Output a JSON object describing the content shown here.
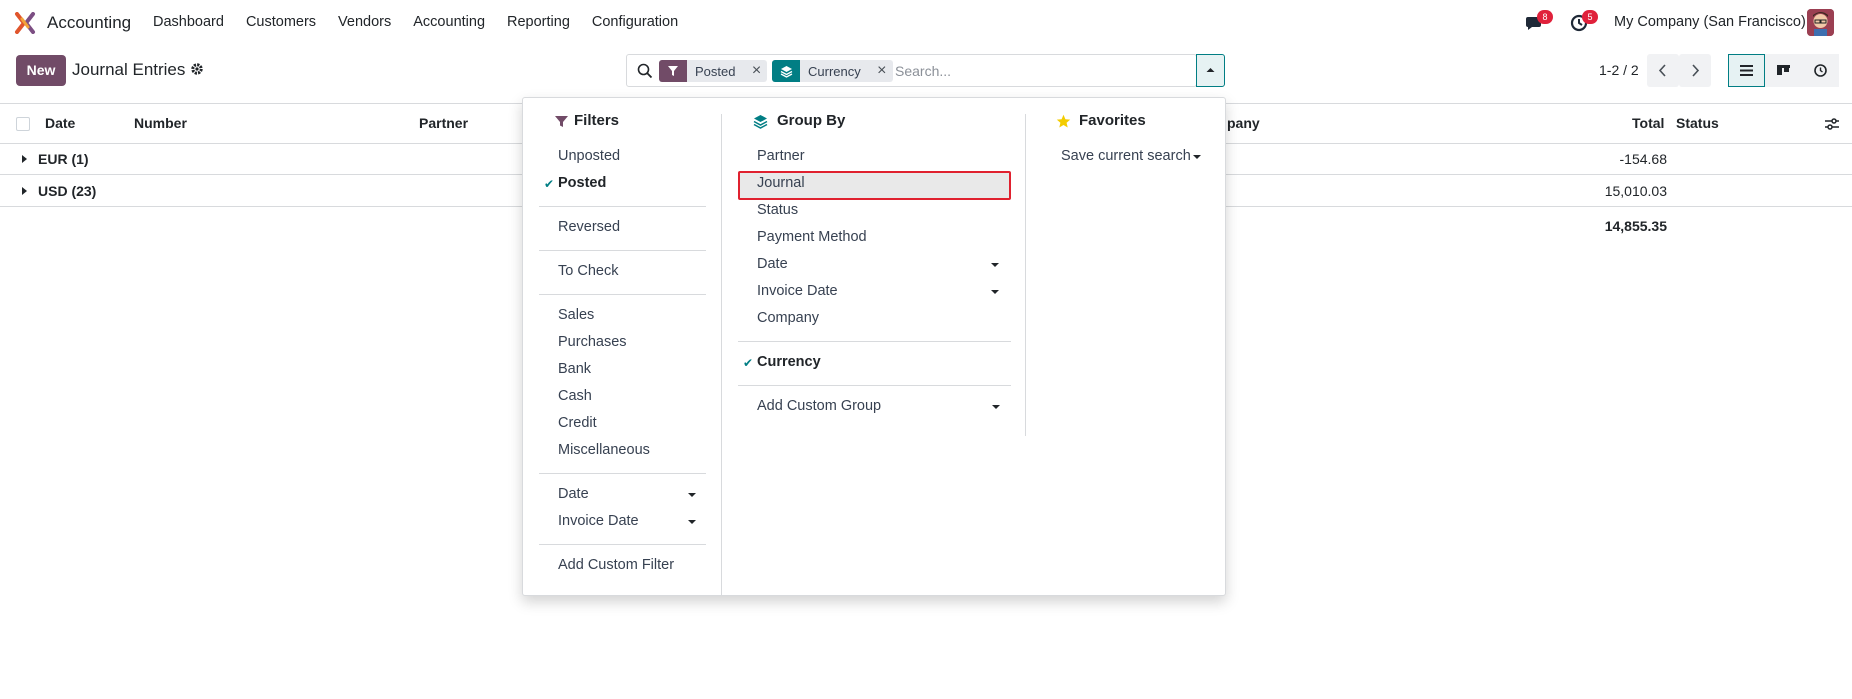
{
  "navbar": {
    "app_name": "Accounting",
    "menu": [
      "Dashboard",
      "Customers",
      "Vendors",
      "Accounting",
      "Reporting",
      "Configuration"
    ],
    "messages_count": "8",
    "activities_count": "5",
    "company": "My Company (San Francisco)"
  },
  "control_panel": {
    "new_label": "New",
    "title": "Journal Entries",
    "search": {
      "facets": [
        {
          "icon": "filter-icon",
          "label": "Posted",
          "color": "#714b67"
        },
        {
          "icon": "layers-icon",
          "label": "Currency",
          "color": "#017e84"
        }
      ],
      "placeholder": "Search..."
    },
    "pager": "1-2 / 2"
  },
  "list": {
    "columns": [
      "Date",
      "Number",
      "Partner",
      "pany",
      "Total",
      "Status"
    ],
    "groups": [
      {
        "label": "EUR (1)",
        "total": "-154.68"
      },
      {
        "label": "USD (23)",
        "total": "15,010.03"
      }
    ],
    "grand_total": "14,855.35"
  },
  "dropdown": {
    "filters": {
      "title": "Filters",
      "items": [
        {
          "label": "Unposted",
          "selected": false
        },
        {
          "label": "Posted",
          "selected": true
        },
        {
          "label": "Reversed",
          "selected": false
        },
        {
          "label": "To Check",
          "selected": false
        },
        {
          "label": "Sales",
          "selected": false
        },
        {
          "label": "Purchases",
          "selected": false
        },
        {
          "label": "Bank",
          "selected": false
        },
        {
          "label": "Cash",
          "selected": false
        },
        {
          "label": "Credit",
          "selected": false
        },
        {
          "label": "Miscellaneous",
          "selected": false
        },
        {
          "label": "Date",
          "selected": false
        },
        {
          "label": "Invoice Date",
          "selected": false
        },
        {
          "label": "Add Custom Filter",
          "selected": false
        }
      ]
    },
    "group_by": {
      "title": "Group By",
      "items": [
        {
          "label": "Partner",
          "selected": false
        },
        {
          "label": "Journal",
          "selected": false
        },
        {
          "label": "Status",
          "selected": false
        },
        {
          "label": "Payment Method",
          "selected": false
        },
        {
          "label": "Date",
          "selected": false
        },
        {
          "label": "Invoice Date",
          "selected": false
        },
        {
          "label": "Company",
          "selected": false
        },
        {
          "label": "Currency",
          "selected": true
        },
        {
          "label": "Add Custom Group",
          "selected": false
        }
      ]
    },
    "favorites": {
      "title": "Favorites",
      "save_label": "Save current search"
    }
  },
  "colors": {
    "brand": "#714b67",
    "accent": "#017e84",
    "badge": "#e0213b",
    "favorite_star": "#f3cc00"
  }
}
